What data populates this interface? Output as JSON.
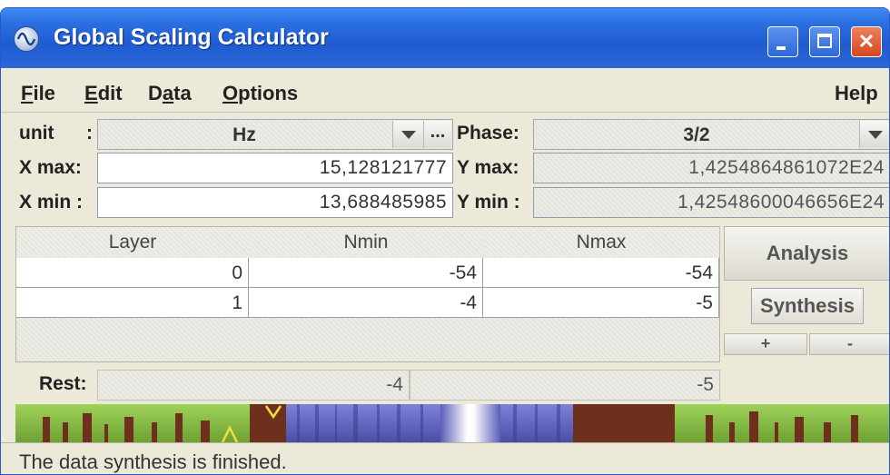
{
  "window": {
    "title": "Global Scaling Calculator",
    "icon": "sine-wave-icon"
  },
  "titlebar_buttons": {
    "minimize": "minimize-icon",
    "maximize": "maximize-icon",
    "close": "✕"
  },
  "menu": {
    "file": {
      "first": "F",
      "rest": "ile"
    },
    "edit": {
      "first": "E",
      "rest": "dit"
    },
    "data": {
      "pre": "D",
      "mid": "a",
      "post": "ta"
    },
    "options": {
      "first": "O",
      "rest": "ptions"
    },
    "help": "Help"
  },
  "params": {
    "unit_label": "unit",
    "unit_colon": ":",
    "unit_value": "Hz",
    "unit_more": "...",
    "phase_label": "Phase:",
    "phase_value": "3/2",
    "xmax_label": "X max:",
    "xmax_value": "15,128121777",
    "xmin_label": "X min :",
    "xmin_value": "13,688485985",
    "ymax_label": "Y max:",
    "ymax_value": "1,4254864861072E24",
    "ymin_label": "Y min :",
    "ymin_value": "1,42548600046656E24"
  },
  "table": {
    "headers": [
      "Layer",
      "Nmin",
      "Nmax"
    ],
    "rows": [
      {
        "layer": "0",
        "nmin": "-54",
        "nmax": "-54"
      },
      {
        "layer": "1",
        "nmin": "-4",
        "nmax": "-5"
      }
    ]
  },
  "rest": {
    "label": "Rest:",
    "nmin": "-4",
    "nmax": "-5"
  },
  "buttons": {
    "analysis": "Analysis",
    "synthesis": "Synthesis",
    "plus": "+",
    "minus": "-"
  },
  "status": "The data synthesis is finished.",
  "colors": {
    "titlebar": "#2a6fe0",
    "window_bg": "#ece9d8",
    "stripe_green": "#7fb43c",
    "stripe_brown": "#6e2f1c",
    "stripe_blue": "#5b5fb8",
    "stripe_yellow": "#f0e040"
  }
}
